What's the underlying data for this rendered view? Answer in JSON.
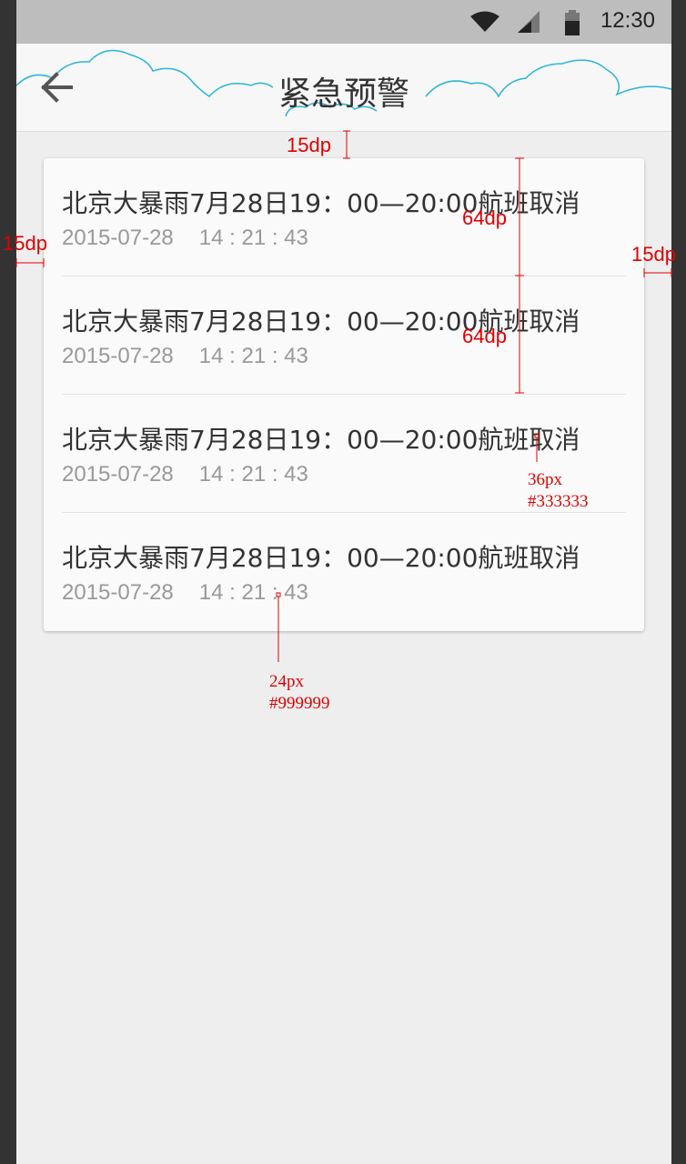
{
  "status_bar": {
    "time": "12:30"
  },
  "app_bar": {
    "title": "紧急预警",
    "back_icon": "arrow-left-icon"
  },
  "alerts": [
    {
      "headline": "北京大暴雨7月28日19：00—20:00航班取消",
      "date": "2015-07-28",
      "time": "14 : 21 : 43"
    },
    {
      "headline": "北京大暴雨7月28日19：00—20:00航班取消",
      "date": "2015-07-28",
      "time": "14 : 21 : 43"
    },
    {
      "headline": "北京大暴雨7月28日19：00—20:00航班取消",
      "date": "2015-07-28",
      "time": "14 : 21 : 43"
    },
    {
      "headline": "北京大暴雨7月28日19：00—20:00航班取消",
      "date": "2015-07-28",
      "time": "14 : 21 : 43"
    }
  ],
  "annotations": {
    "top_margin": "15dp",
    "left_margin": "15dp",
    "right_margin": "15dp",
    "row_height_1": "64dp",
    "row_height_2": "64dp",
    "headline_size": "36px",
    "headline_color": "#333333",
    "stamp_size": "24px",
    "stamp_color": "#999999"
  },
  "colors": {
    "headline": "#333333",
    "stamp": "#999999",
    "annotation": "#e00000",
    "cloud_outline": "#29b6d6"
  }
}
